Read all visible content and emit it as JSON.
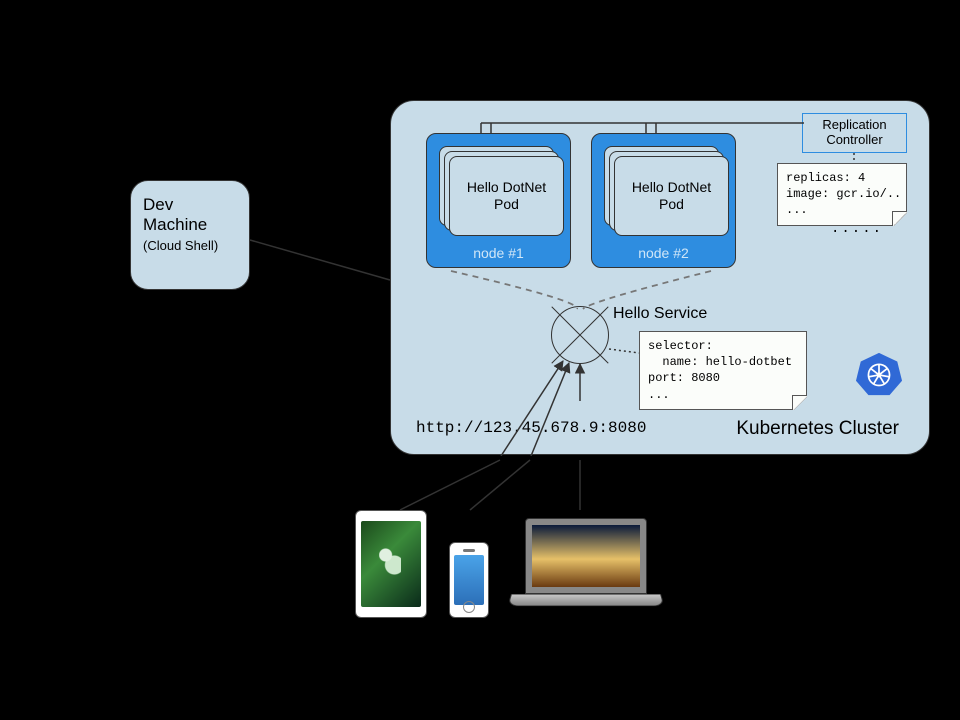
{
  "dev": {
    "title": "Dev\nMachine",
    "sub": "(Cloud Shell)"
  },
  "cluster": {
    "label": "Kubernetes Cluster",
    "node1": {
      "label": "node #1",
      "pod": "Hello DotNet\nPod"
    },
    "node2": {
      "label": "node #2",
      "pod": "Hello DotNet\nPod"
    },
    "rc": {
      "title": "Replication\nController",
      "yaml": "replicas: 4\nimage: gcr.io/..\n...",
      "dots": "....."
    },
    "service": {
      "label": "Hello Service",
      "yaml": "selector:\n  name: hello-dotbet\nport: 8080\n..."
    },
    "url": "http://123.45.678.9:8080"
  }
}
